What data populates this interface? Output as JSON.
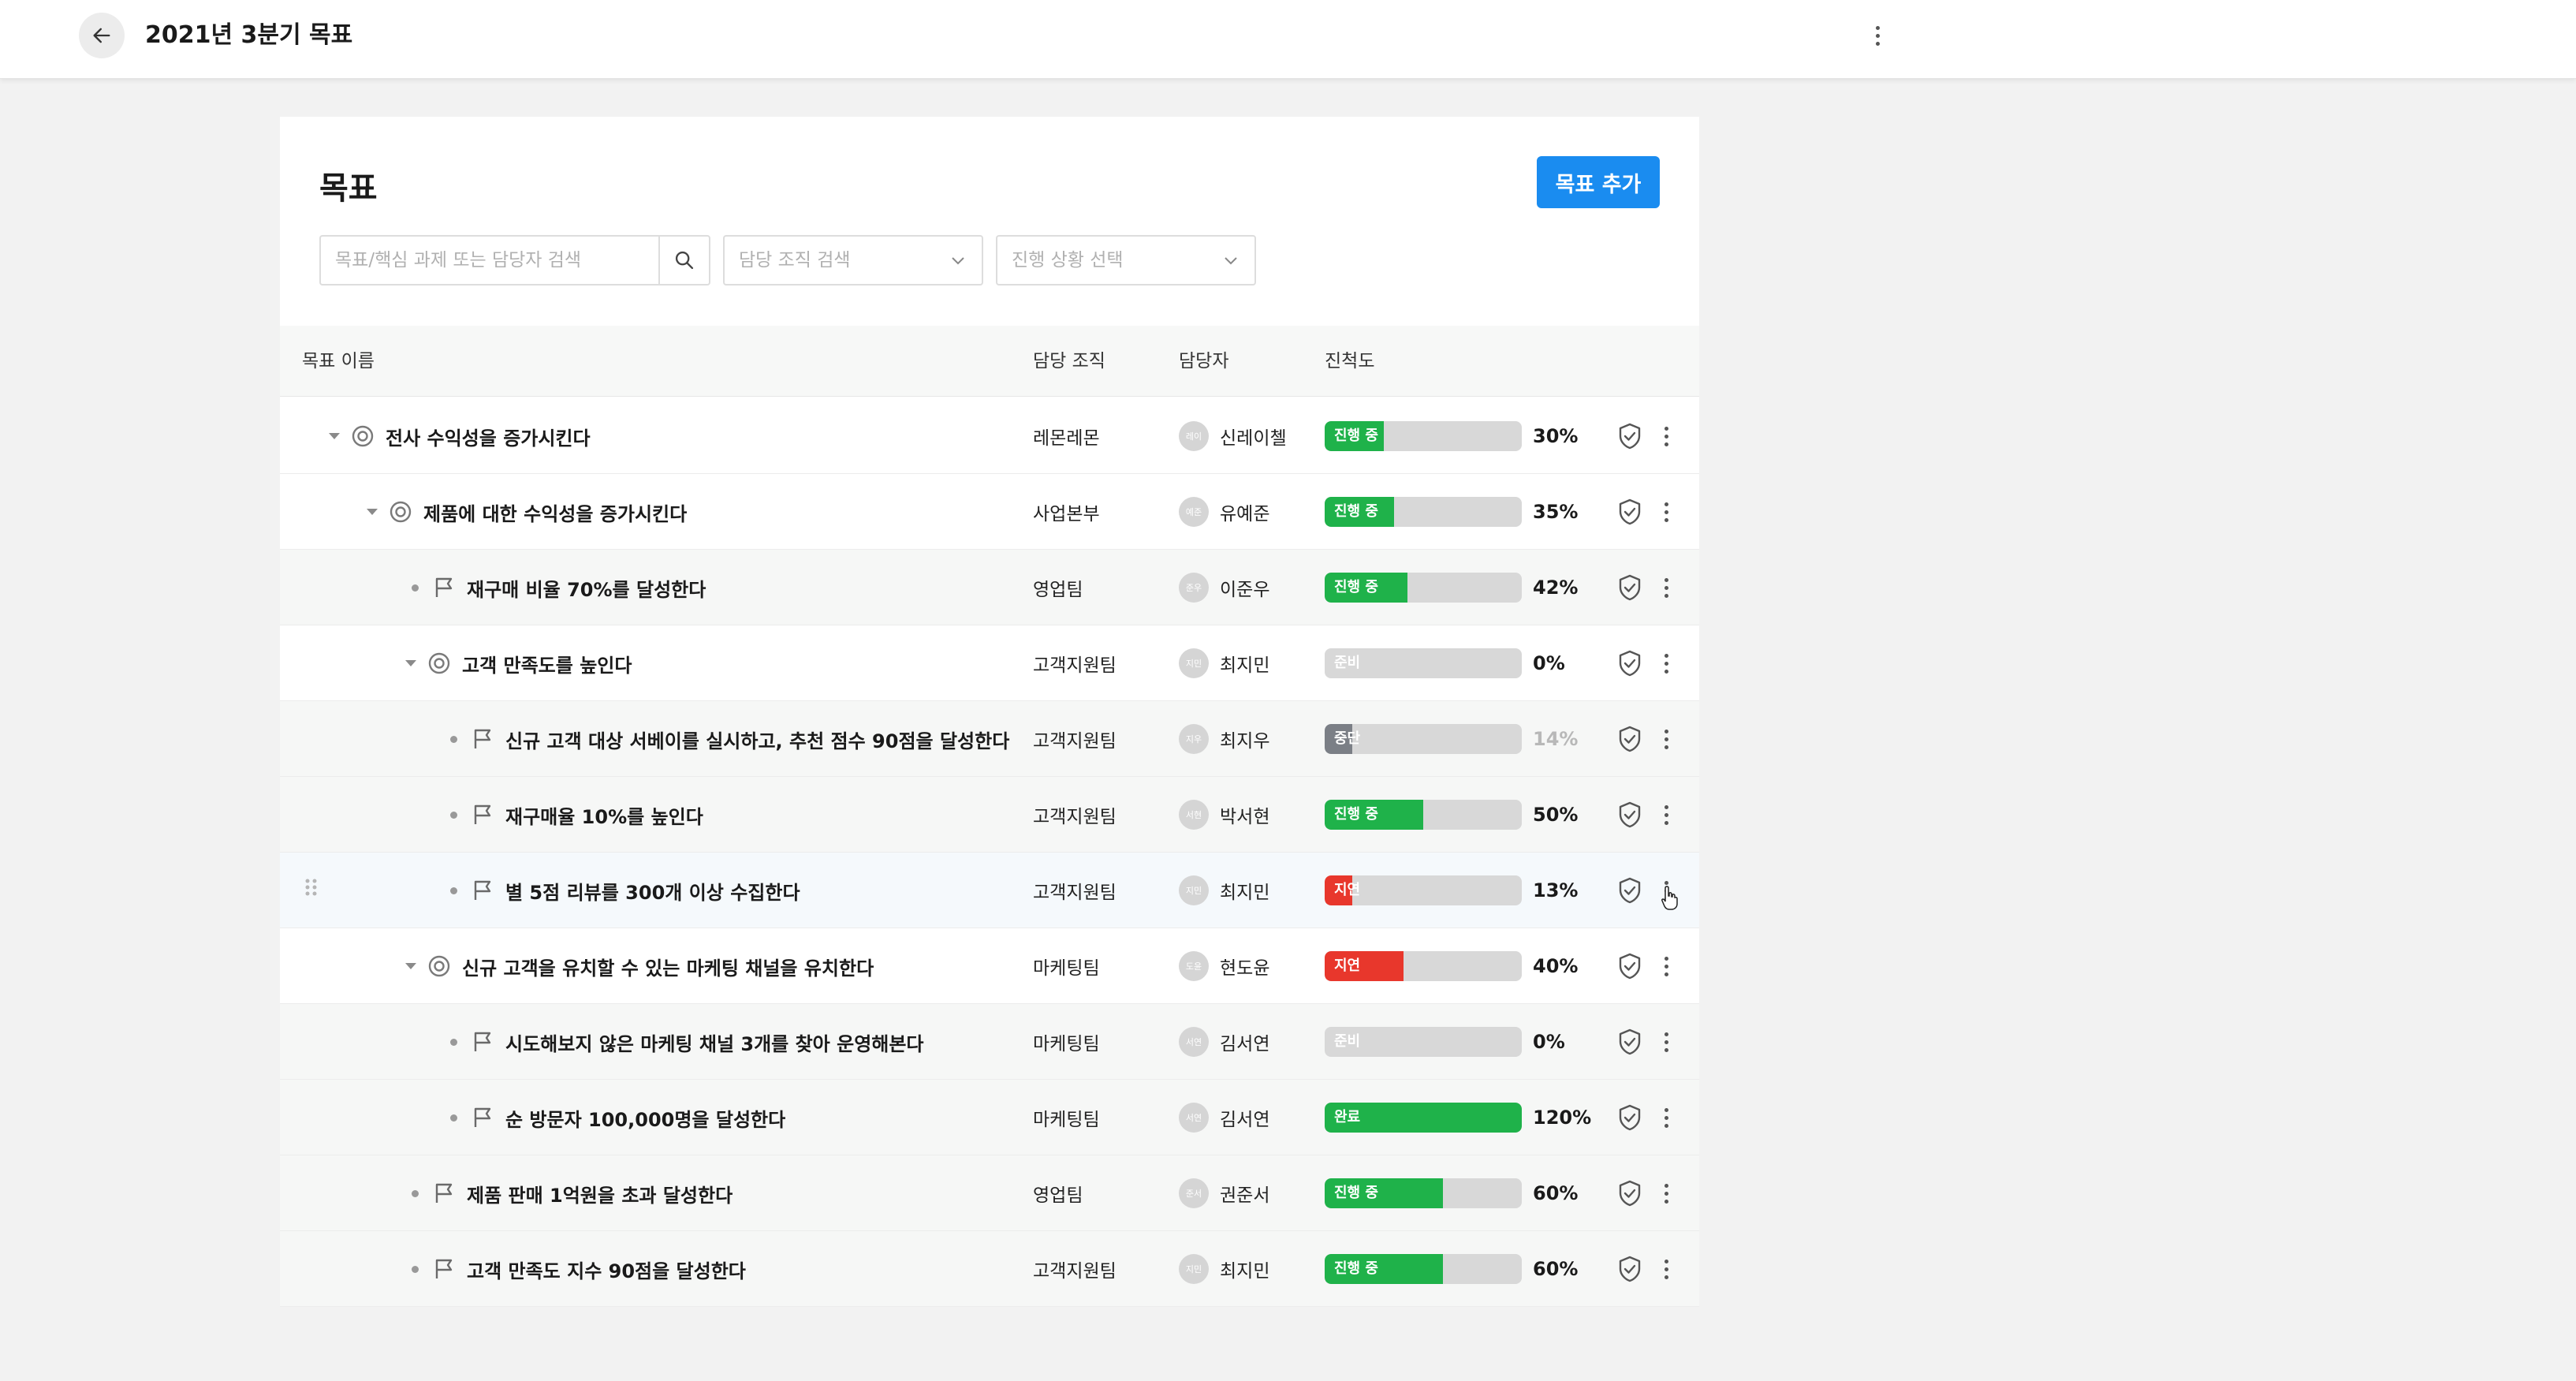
{
  "header": {
    "title": "2021년 3분기 목표"
  },
  "card": {
    "title": "목표",
    "add_button": "목표 추가",
    "search_placeholder": "목표/핵심 과제 또는 담당자 검색",
    "org_select_placeholder": "담당 조직 검색",
    "status_select_placeholder": "진행 상황 선택"
  },
  "table": {
    "columns": [
      "목표 이름",
      "담당 조직",
      "담당자",
      "진척도"
    ],
    "rows": [
      {
        "level": 0,
        "type": "goal",
        "expandable": true,
        "name": "전사 수익성을 증가시킨다",
        "org": "레몬레몬",
        "avatar": "레이",
        "owner": "신레이첼",
        "status": "진행 중",
        "status_color": "#1fb24a",
        "progress": 30,
        "progress_text": "30%"
      },
      {
        "level": 1,
        "type": "goal",
        "expandable": true,
        "name": "제품에 대한 수익성을 증가시킨다",
        "org": "사업본부",
        "avatar": "예준",
        "owner": "유예준",
        "status": "진행 중",
        "status_color": "#1fb24a",
        "progress": 35,
        "progress_text": "35%"
      },
      {
        "level": 2,
        "type": "task",
        "expandable": false,
        "name": "재구매 비율 70%를 달성한다",
        "org": "영업팀",
        "avatar": "준우",
        "owner": "이준우",
        "status": "진행 중",
        "status_color": "#1fb24a",
        "progress": 42,
        "progress_text": "42%"
      },
      {
        "level": 2,
        "type": "goal",
        "expandable": true,
        "name": "고객 만족도를 높인다",
        "org": "고객지원팀",
        "avatar": "지민",
        "owner": "최지민",
        "status": "준비",
        "status_color": "#d8d8d8",
        "progress": 0,
        "progress_text": "0%"
      },
      {
        "level": 3,
        "type": "task",
        "expandable": false,
        "name": "신규 고객 대상 서베이를 실시하고, 추천 점수 90점을 달성한다",
        "org": "고객지원팀",
        "avatar": "지우",
        "owner": "최지우",
        "status": "중단",
        "status_color": "#7b7f86",
        "progress": 14,
        "progress_text": "14%",
        "muted": true
      },
      {
        "level": 3,
        "type": "task",
        "expandable": false,
        "name": "재구매율 10%를 높인다",
        "org": "고객지원팀",
        "avatar": "서현",
        "owner": "박서현",
        "status": "진행 중",
        "status_color": "#1fb24a",
        "progress": 50,
        "progress_text": "50%"
      },
      {
        "level": 3,
        "type": "task",
        "expandable": false,
        "name": "별 5점 리뷰를 300개 이상 수집한다",
        "org": "고객지원팀",
        "avatar": "지민",
        "owner": "최지민",
        "status": "지연",
        "status_color": "#e8372c",
        "progress": 13,
        "progress_text": "13%"
      },
      {
        "level": 2,
        "type": "goal",
        "expandable": true,
        "name": "신규 고객을 유치할 수 있는 마케팅 채널을 유치한다",
        "org": "마케팅팀",
        "avatar": "도윤",
        "owner": "현도윤",
        "status": "지연",
        "status_color": "#e8372c",
        "progress": 40,
        "progress_text": "40%"
      },
      {
        "level": 3,
        "type": "task",
        "expandable": false,
        "name": "시도해보지 않은 마케팅 채널 3개를 찾아 운영해본다",
        "org": "마케팅팀",
        "avatar": "서연",
        "owner": "김서연",
        "status": "준비",
        "status_color": "#d8d8d8",
        "progress": 0,
        "progress_text": "0%"
      },
      {
        "level": 3,
        "type": "task",
        "expandable": false,
        "name": "순 방문자 100,000명을 달성한다",
        "org": "마케팅팀",
        "avatar": "서연",
        "owner": "김서연",
        "status": "완료",
        "status_color": "#1fb24a",
        "progress": 120,
        "progress_text": "120%"
      },
      {
        "level": 2,
        "type": "task",
        "expandable": false,
        "name": "제품 판매 1억원을 초과 달성한다",
        "org": "영업팀",
        "avatar": "준서",
        "owner": "권준서",
        "status": "진행 중",
        "status_color": "#1fb24a",
        "progress": 60,
        "progress_text": "60%"
      },
      {
        "level": 2,
        "type": "task",
        "expandable": false,
        "name": "고객 만족도 지수 90점을 달성한다",
        "org": "고객지원팀",
        "avatar": "지민",
        "owner": "최지민",
        "status": "진행 중",
        "status_color": "#1fb24a",
        "progress": 60,
        "progress_text": "60%"
      }
    ]
  }
}
